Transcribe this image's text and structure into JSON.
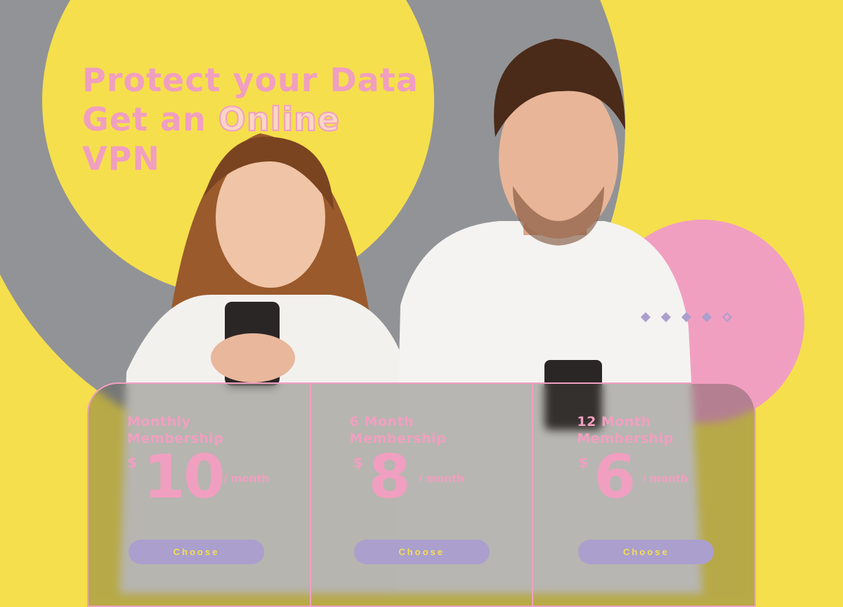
{
  "hero": {
    "line1": "Protect your Data",
    "line2_prefix": "Get an",
    "line2_outline": "Online",
    "line3": "VPN"
  },
  "colors": {
    "yellow": "#f5df4d",
    "gray": "#929396",
    "pink": "#f19fc0",
    "purple": "#ab9fce"
  },
  "plans": [
    {
      "title_line1": "Monthly",
      "title_line2": "Membership",
      "currency": "$",
      "amount": "10",
      "period": "/ month",
      "button": "Choose"
    },
    {
      "title_line1": "6 Month",
      "title_line2": "Membership",
      "currency": "$",
      "amount": "8",
      "period": "/ month",
      "button": "Choose"
    },
    {
      "title_line1": "12 Month",
      "title_line2": "Membership",
      "currency": "$",
      "amount": "6",
      "period": "/ month",
      "button": "Choose"
    }
  ],
  "carousel": {
    "dots": 5,
    "active": 4
  }
}
